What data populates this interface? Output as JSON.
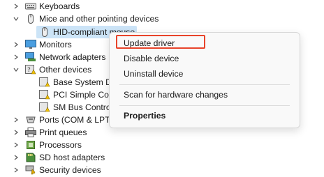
{
  "tree": {
    "keyboards": "Keyboards",
    "mice": "Mice and other pointing devices",
    "hid_mouse": "HID-compliant mouse",
    "monitors": "Monitors",
    "network_adapters": "Network adapters",
    "other_devices": "Other devices",
    "base_system": "Base System De",
    "pci_simple": "PCI Simple Cor",
    "sm_bus": "SM Bus Contro",
    "ports": "Ports (COM & LPT)",
    "print_queues": "Print queues",
    "processors": "Processors",
    "sd_host": "SD host adapters",
    "security_devices": "Security devices"
  },
  "context_menu": {
    "update_driver": "Update driver",
    "disable_device": "Disable device",
    "uninstall_device": "Uninstall device",
    "scan_hardware": "Scan for hardware changes",
    "properties": "Properties"
  },
  "colors": {
    "selection": "#cce4f7",
    "highlight_border": "#e8432a"
  },
  "icons": {
    "chevron_right": "chevron-right-icon",
    "chevron_down": "chevron-down-icon"
  }
}
